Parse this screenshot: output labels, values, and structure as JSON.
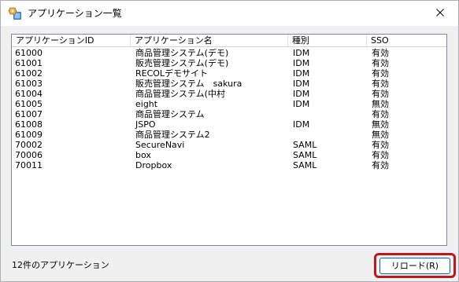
{
  "window": {
    "title": "アプリケーション一覧",
    "icon": "app-window-icon",
    "close_icon": "close-icon"
  },
  "table": {
    "columns": [
      "アプリケーションID",
      "アプリケーション名",
      "種別",
      "SSO"
    ],
    "rows": [
      {
        "id": "61000",
        "name": "商品管理システム(デモ)",
        "type": "IDM",
        "sso": "有効"
      },
      {
        "id": "61001",
        "name": "販売管理システム(デモ)",
        "type": "IDM",
        "sso": "有効"
      },
      {
        "id": "61002",
        "name": "RECOLデモサイト",
        "type": "IDM",
        "sso": "有効"
      },
      {
        "id": "61003",
        "name": "販売管理システム　sakura",
        "type": "IDM",
        "sso": "有効"
      },
      {
        "id": "61004",
        "name": "商品管理システム(中村",
        "type": "IDM",
        "sso": "有効"
      },
      {
        "id": "61005",
        "name": "eight",
        "type": "IDM",
        "sso": "無効"
      },
      {
        "id": "61007",
        "name": "商品管理システム",
        "type": "",
        "sso": "有効"
      },
      {
        "id": "61008",
        "name": "JSPO",
        "type": "IDM",
        "sso": "無効"
      },
      {
        "id": "61009",
        "name": "商品管理システム2",
        "type": "",
        "sso": "無効"
      },
      {
        "id": "70002",
        "name": "SecureNavi",
        "type": "SAML",
        "sso": "有効"
      },
      {
        "id": "70006",
        "name": "box",
        "type": "SAML",
        "sso": "有効"
      },
      {
        "id": "70011",
        "name": "Dropbox",
        "type": "SAML",
        "sso": "有効"
      }
    ]
  },
  "status": {
    "count_text": "12件のアプリケーション"
  },
  "buttons": {
    "reload_label": "リロード(R)"
  },
  "colors": {
    "highlight": "#c0171c",
    "button_border": "#0067c0"
  }
}
